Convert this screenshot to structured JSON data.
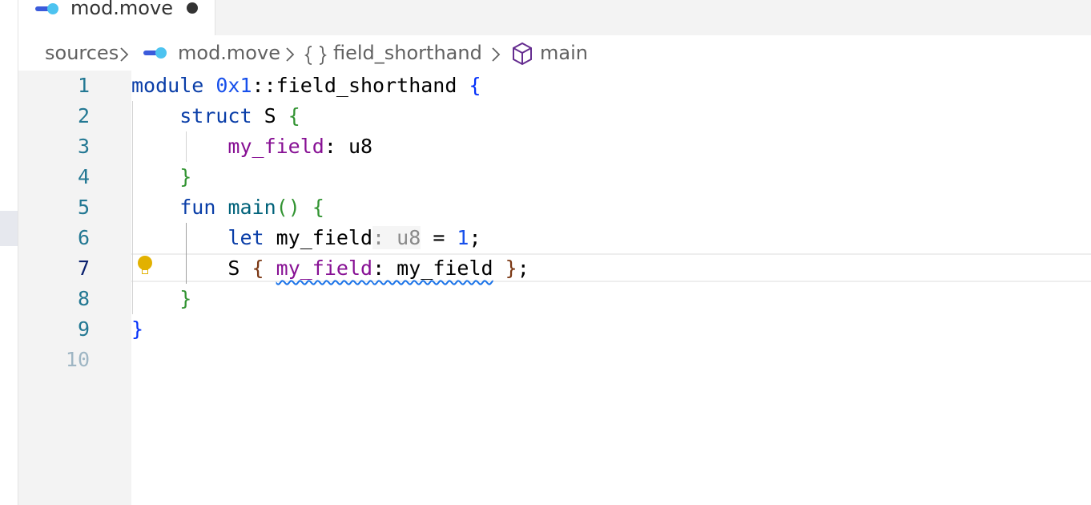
{
  "tab": {
    "title": "mod.move",
    "icon": "move-file-icon",
    "dirty": true
  },
  "breadcrumb": {
    "items": [
      "sources",
      "mod.move",
      "field_shorthand",
      "main"
    ],
    "icons": [
      "move-file-icon",
      "braces-icon",
      "cube-icon"
    ]
  },
  "editor": {
    "line_numbers": [
      "1",
      "2",
      "3",
      "4",
      "5",
      "6",
      "7",
      "8",
      "9",
      "10"
    ],
    "active_line": "7",
    "lines": [
      {
        "tokens": [
          "module",
          " ",
          "0x1",
          "::field_shorthand",
          " ",
          "{"
        ]
      },
      {
        "tokens": [
          "    ",
          "struct",
          " S ",
          "{"
        ]
      },
      {
        "tokens": [
          "        ",
          "my_field",
          ": u8"
        ]
      },
      {
        "tokens": [
          "    ",
          "}"
        ]
      },
      {
        "tokens": [
          "    ",
          "fun",
          " ",
          "main",
          "()",
          " ",
          "{"
        ]
      },
      {
        "tokens": [
          "        ",
          "let",
          " my_field",
          ": u8",
          " = ",
          "1",
          ";"
        ]
      },
      {
        "tokens": [
          "        S ",
          "{",
          " ",
          "my_field",
          ": my_field",
          " ",
          "}",
          ";"
        ]
      },
      {
        "tokens": [
          "    ",
          "}"
        ]
      },
      {
        "tokens": [
          "}"
        ]
      },
      {
        "tokens": [
          ""
        ]
      }
    ]
  },
  "lightbulb": {
    "icon": "lightbulb-icon"
  },
  "colors": {
    "keyword": "#0000ff",
    "field": "#871094",
    "number": "#1750eb",
    "bracket_level1": "#0431fa",
    "bracket_level2": "#319331",
    "bracket_level3": "#7b3814",
    "lightbulb": "#e2b100",
    "squiggle": "#1a73e8"
  }
}
